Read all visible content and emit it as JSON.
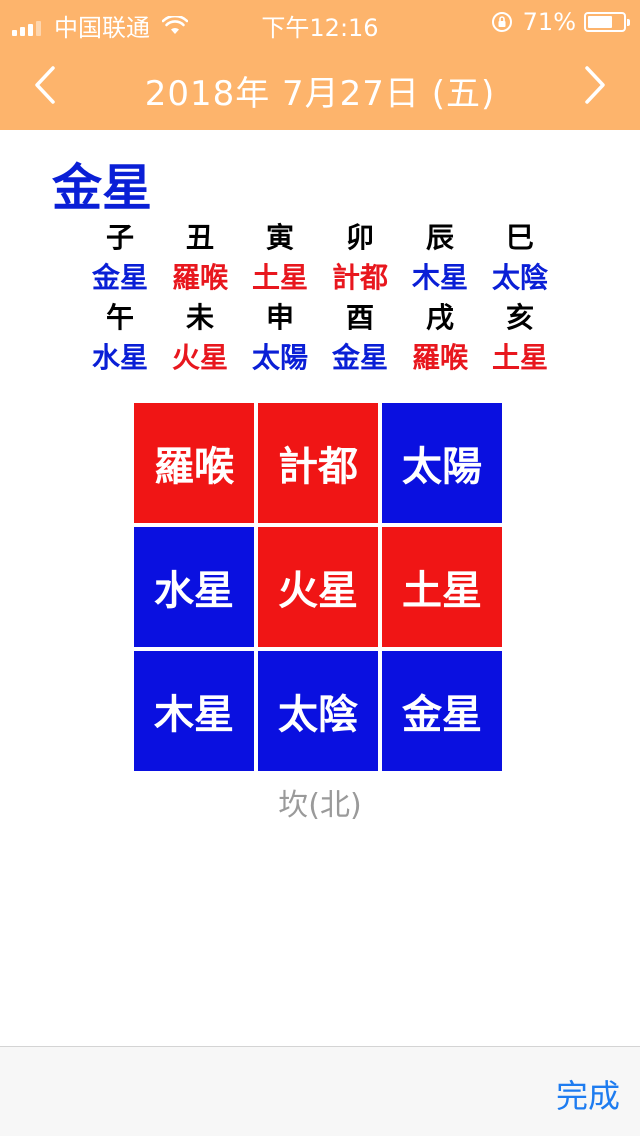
{
  "status": {
    "carrier": "中国联通",
    "time": "下午12:16",
    "battery_pct": "71%",
    "battery_level": 0.71
  },
  "nav": {
    "title": "2018年 7月27日 (五)"
  },
  "planet_title": "金星",
  "zodiac_rows": [
    {
      "branches": [
        "子",
        "丑",
        "寅",
        "卯",
        "辰",
        "巳"
      ],
      "planets": [
        {
          "name": "金星",
          "color": "#0A1FD6"
        },
        {
          "name": "羅喉",
          "color": "#E8171E"
        },
        {
          "name": "土星",
          "color": "#E8171E"
        },
        {
          "name": "計都",
          "color": "#E8171E"
        },
        {
          "name": "木星",
          "color": "#0A1FD6"
        },
        {
          "name": "太陰",
          "color": "#0A1FD6"
        }
      ]
    },
    {
      "branches": [
        "午",
        "未",
        "申",
        "酉",
        "戌",
        "亥"
      ],
      "planets": [
        {
          "name": "水星",
          "color": "#0A1FD6"
        },
        {
          "name": "火星",
          "color": "#E8171E"
        },
        {
          "name": "太陽",
          "color": "#0A1FD6"
        },
        {
          "name": "金星",
          "color": "#0A1FD6"
        },
        {
          "name": "羅喉",
          "color": "#E8171E"
        },
        {
          "name": "土星",
          "color": "#E8171E"
        }
      ]
    }
  ],
  "grid": [
    {
      "name": "羅喉",
      "color": "#F01515"
    },
    {
      "name": "計都",
      "color": "#F01515"
    },
    {
      "name": "太陽",
      "color": "#0A10E0"
    },
    {
      "name": "水星",
      "color": "#0A10E0"
    },
    {
      "name": "火星",
      "color": "#F01515"
    },
    {
      "name": "土星",
      "color": "#F01515"
    },
    {
      "name": "木星",
      "color": "#0A10E0"
    },
    {
      "name": "太陰",
      "color": "#0A10E0"
    },
    {
      "name": "金星",
      "color": "#0A10E0"
    }
  ],
  "direction": "坎(北)",
  "bottom": {
    "done_label": "完成"
  },
  "colors": {
    "header_bg": "#FDB46C",
    "accent_blue": "#0A1FD6",
    "accent_red": "#E8171E",
    "done_blue": "#1E7CF0"
  }
}
